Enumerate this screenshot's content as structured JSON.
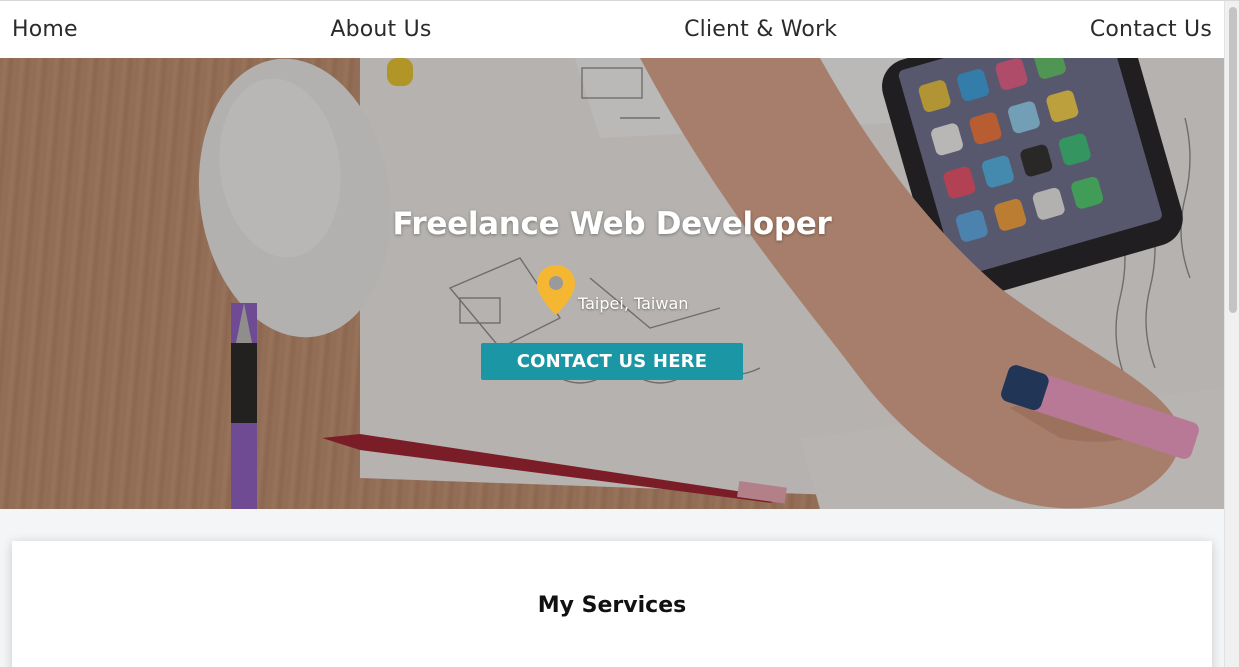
{
  "nav": {
    "items": [
      {
        "label": "Home"
      },
      {
        "label": "About Us"
      },
      {
        "label": "Client & Work"
      },
      {
        "label": "Contact Us"
      }
    ]
  },
  "hero": {
    "title": "Freelance Web Developer",
    "location": "Taipei, Taiwan",
    "location_icon": "map-pin-icon",
    "cta_label": "CONTACT US HERE",
    "cta_color": "#1a96a4",
    "pin_color": "#f5b731"
  },
  "services": {
    "title": "My Services"
  }
}
